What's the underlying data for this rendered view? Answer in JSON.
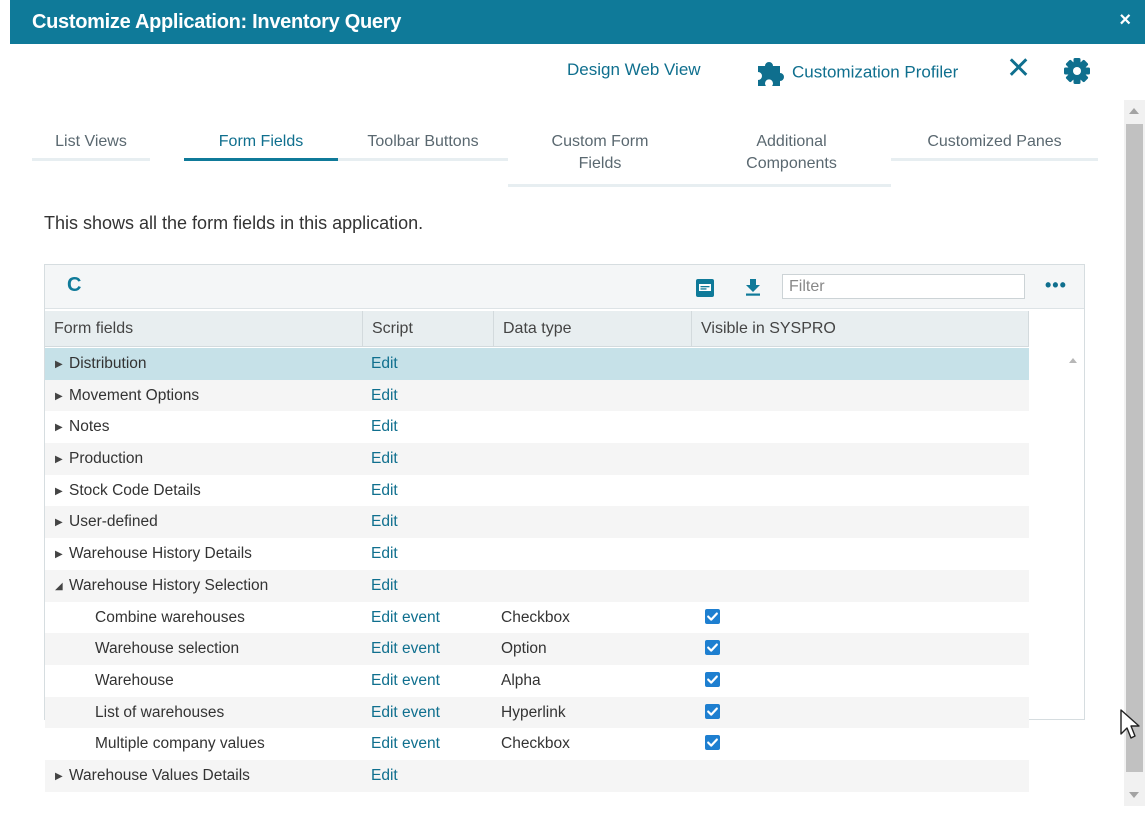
{
  "window": {
    "title": "Customize Application: Inventory Query",
    "close_glyph": "×",
    "title_bar_color": "#0f7a99"
  },
  "topbar": {
    "design_web_view": "Design Web View",
    "customization_profiler": "Customization Profiler",
    "close_glyph": "✕",
    "icons": [
      "puzzle-icon",
      "close-icon",
      "gear-icon"
    ]
  },
  "tabs": [
    {
      "label": "List Views",
      "active": false
    },
    {
      "label": "Form Fields",
      "active": true
    },
    {
      "label": "Toolbar Buttons",
      "active": false
    },
    {
      "label": "Custom Form\nFields",
      "active": false
    },
    {
      "label": "Additional\nComponents",
      "active": false
    },
    {
      "label": "Customized Panes",
      "active": false
    }
  ],
  "description": "This shows all the form fields in this application.",
  "grid": {
    "toolbar": {
      "refresh_glyph": "C",
      "filter_placeholder": "Filter",
      "more_glyph": "•••",
      "icons": [
        "refresh-icon",
        "pdf-icon",
        "download-icon",
        "more-icon"
      ]
    },
    "columns": [
      "Form fields",
      "Script",
      "Data type",
      "Visible in SYSPRO"
    ],
    "rows": [
      {
        "name": "Distribution",
        "script": "Edit",
        "type": "",
        "visible": false,
        "expander": "collapsed",
        "child": false,
        "selected": true
      },
      {
        "name": "Movement Options",
        "script": "Edit",
        "type": "",
        "visible": false,
        "expander": "collapsed",
        "child": false
      },
      {
        "name": "Notes",
        "script": "Edit",
        "type": "",
        "visible": false,
        "expander": "collapsed",
        "child": false
      },
      {
        "name": "Production",
        "script": "Edit",
        "type": "",
        "visible": false,
        "expander": "collapsed",
        "child": false
      },
      {
        "name": "Stock Code Details",
        "script": "Edit",
        "type": "",
        "visible": false,
        "expander": "collapsed",
        "child": false
      },
      {
        "name": "User-defined",
        "script": "Edit",
        "type": "",
        "visible": false,
        "expander": "collapsed",
        "child": false
      },
      {
        "name": "Warehouse History Details",
        "script": "Edit",
        "type": "",
        "visible": false,
        "expander": "collapsed",
        "child": false
      },
      {
        "name": "Warehouse History Selection",
        "script": "Edit",
        "type": "",
        "visible": false,
        "expander": "expanded",
        "child": false
      },
      {
        "name": "Combine warehouses",
        "script": "Edit event",
        "type": "Checkbox",
        "visible": true,
        "expander": "",
        "child": true
      },
      {
        "name": "Warehouse selection",
        "script": "Edit event",
        "type": "Option",
        "visible": true,
        "expander": "",
        "child": true
      },
      {
        "name": "Warehouse",
        "script": "Edit event",
        "type": "Alpha",
        "visible": true,
        "expander": "",
        "child": true
      },
      {
        "name": "List of warehouses",
        "script": "Edit event",
        "type": "Hyperlink",
        "visible": true,
        "expander": "",
        "child": true
      },
      {
        "name": "Multiple company values",
        "script": "Edit event",
        "type": "Checkbox",
        "visible": true,
        "expander": "",
        "child": true
      },
      {
        "name": "Warehouse Values Details",
        "script": "Edit",
        "type": "",
        "visible": false,
        "expander": "collapsed",
        "child": false
      }
    ],
    "colors": {
      "accent": "#0f7a99",
      "link": "#0f6f8e",
      "selected_row": "#c6e1e8",
      "checkbox": "#1e7fd0"
    }
  }
}
